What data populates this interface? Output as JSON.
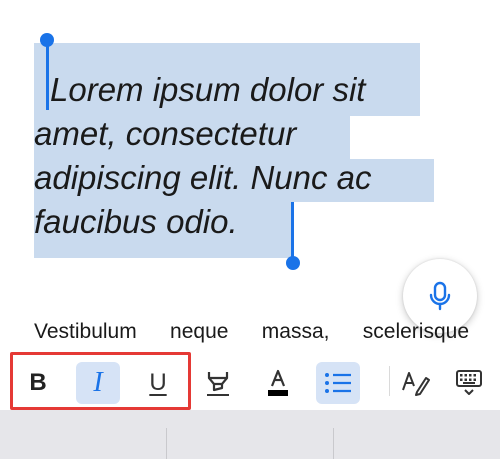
{
  "editor": {
    "selected_lines": [
      "Lorem ipsum dolor sit",
      "amet, consectetur",
      "adipiscing elit. Nunc ac",
      "faucibus odio."
    ],
    "body_line": "Vestibulum neque massa, scelerisque"
  },
  "mic_button": {
    "icon": "microphone-icon"
  },
  "toolbar": {
    "bold_label": "B",
    "italic_label": "I",
    "underline_label": "U",
    "items": [
      {
        "name": "bold",
        "icon": "bold-icon",
        "active": false
      },
      {
        "name": "italic",
        "icon": "italic-icon",
        "active": true
      },
      {
        "name": "underline",
        "icon": "underline-icon",
        "active": false
      },
      {
        "name": "highlight",
        "icon": "highlighter-icon",
        "active": false
      },
      {
        "name": "text-color",
        "icon": "text-color-icon",
        "active": false
      },
      {
        "name": "bulleted-list",
        "icon": "bulleted-list-icon",
        "active": true
      },
      {
        "name": "handwriting",
        "icon": "handwriting-icon",
        "active": false
      },
      {
        "name": "keyboard",
        "icon": "keyboard-hide-icon",
        "active": false
      }
    ]
  },
  "colors": {
    "accent": "#1a73e8",
    "selection": "#c9daee",
    "active_tool_bg": "#d6e3f6",
    "annotation": "#e53935",
    "text_color_swatch": "#000000"
  }
}
